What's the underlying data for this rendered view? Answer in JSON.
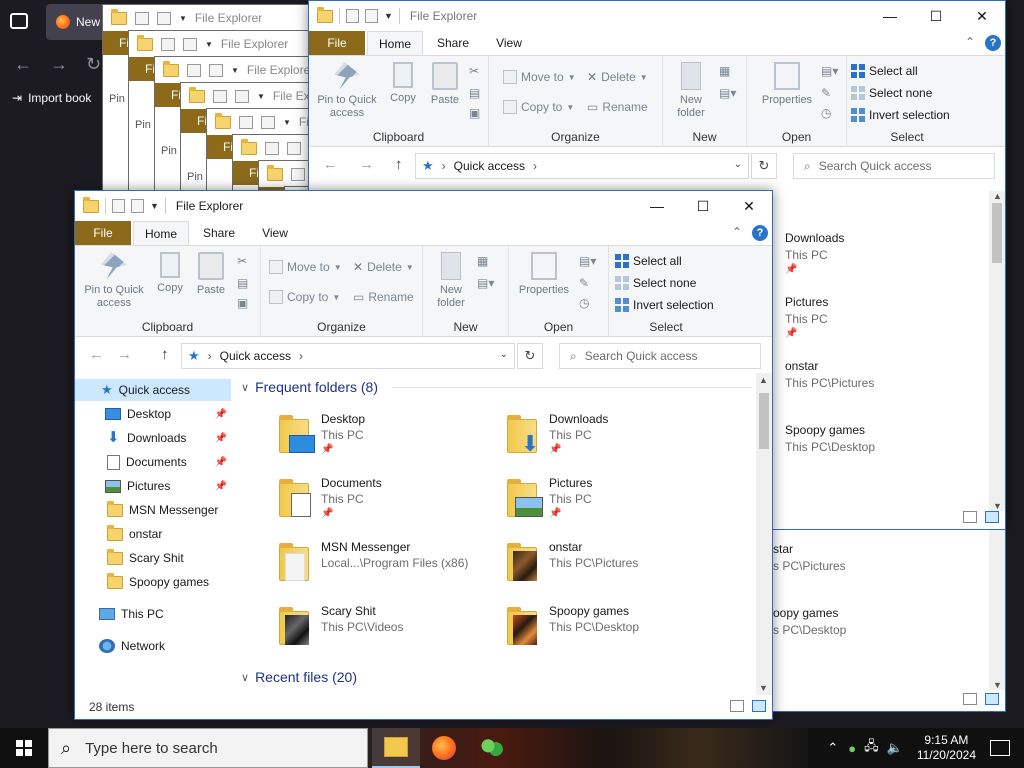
{
  "firefox": {
    "tab_label": "New",
    "bookmark_label": "Import book"
  },
  "stack_windows": {
    "title": "File Explorer",
    "file_label": "Fi",
    "pin_label": "Pin"
  },
  "back_window": {
    "title": "File Explorer",
    "tabs": {
      "file": "File",
      "home": "Home",
      "share": "Share",
      "view": "View"
    },
    "ribbon": {
      "pin": "Pin to Quick access",
      "copy": "Copy",
      "paste": "Paste",
      "clipboard": "Clipboard",
      "move_to": "Move to",
      "copy_to": "Copy to",
      "delete": "Delete",
      "rename": "Rename",
      "organize": "Organize",
      "new_folder": "New folder",
      "new": "New",
      "properties": "Properties",
      "open": "Open",
      "select_all": "Select all",
      "select_none": "Select none",
      "invert_selection": "Invert selection",
      "select": "Select"
    },
    "address": "Quick access",
    "search_placeholder": "Search Quick access",
    "items": [
      {
        "name": "Downloads",
        "sub": "This PC"
      },
      {
        "name": "Pictures",
        "sub": "This PC"
      },
      {
        "name": "onstar",
        "sub": "This PC\\Pictures"
      },
      {
        "name": "Spoopy games",
        "sub": "This PC\\Desktop"
      }
    ],
    "lower_items": [
      {
        "name": "star",
        "sub": "s PC\\Pictures"
      },
      {
        "name": "oopy games",
        "sub": "s PC\\Desktop"
      }
    ]
  },
  "front_window": {
    "title": "File Explorer",
    "tabs": {
      "file": "File",
      "home": "Home",
      "share": "Share",
      "view": "View"
    },
    "ribbon": {
      "pin": "Pin to Quick access",
      "copy": "Copy",
      "paste": "Paste",
      "clipboard": "Clipboard",
      "move_to": "Move to",
      "copy_to": "Copy to",
      "delete": "Delete",
      "rename": "Rename",
      "organize": "Organize",
      "new_folder": "New folder",
      "new": "New",
      "properties": "Properties",
      "open": "Open",
      "select_all": "Select all",
      "select_none": "Select none",
      "invert_selection": "Invert selection",
      "select": "Select"
    },
    "address": "Quick access",
    "search_placeholder": "Search Quick access",
    "nav": [
      {
        "label": "Quick access",
        "icon": "star-icon"
      },
      {
        "label": "Desktop",
        "icon": "desktop-icon",
        "pinned": true
      },
      {
        "label": "Downloads",
        "icon": "download-icon",
        "pinned": true
      },
      {
        "label": "Documents",
        "icon": "documents-icon",
        "pinned": true
      },
      {
        "label": "Pictures",
        "icon": "pictures-icon",
        "pinned": true
      },
      {
        "label": "MSN Messenger",
        "icon": "folder-icon"
      },
      {
        "label": "onstar",
        "icon": "folder-icon"
      },
      {
        "label": "Scary Shit",
        "icon": "folder-icon"
      },
      {
        "label": "Spoopy games",
        "icon": "folder-icon"
      },
      {
        "label": "This PC",
        "icon": "computer-icon"
      },
      {
        "label": "Network",
        "icon": "network-icon"
      }
    ],
    "frequent_header": "Frequent folders (8)",
    "recent_header": "Recent files (20)",
    "folders": [
      {
        "name": "Desktop",
        "sub": "This PC",
        "pinned": true
      },
      {
        "name": "Downloads",
        "sub": "This PC",
        "pinned": true
      },
      {
        "name": "Documents",
        "sub": "This PC",
        "pinned": true
      },
      {
        "name": "Pictures",
        "sub": "This PC",
        "pinned": true
      },
      {
        "name": "MSN Messenger",
        "sub": "Local...\\Program Files (x86)"
      },
      {
        "name": "onstar",
        "sub": "This PC\\Pictures"
      },
      {
        "name": "Scary Shit",
        "sub": "This PC\\Videos"
      },
      {
        "name": "Spoopy games",
        "sub": "This PC\\Desktop"
      }
    ],
    "status": "28 items"
  },
  "taskbar": {
    "search_placeholder": "Type here to search",
    "time": "9:15 AM",
    "date": "11/20/2024"
  },
  "colors": {
    "file_tab": "#8c6a1a",
    "accent": "#2a73c9",
    "selection": "#cce8ff"
  }
}
